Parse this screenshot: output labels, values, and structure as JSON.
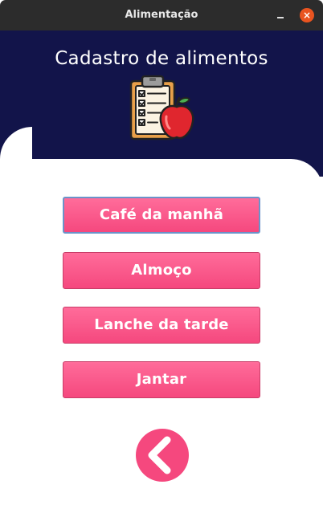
{
  "window": {
    "title": "Alimentação",
    "controls": {
      "minimize": "–",
      "close": "×"
    }
  },
  "header": {
    "title": "Cadastro de alimentos",
    "icon": "clipboard-apple-icon"
  },
  "menu": {
    "items": [
      {
        "label": "Café da manhã",
        "focused": true
      },
      {
        "label": "Almoço",
        "focused": false
      },
      {
        "label": "Lanche da tarde",
        "focused": false
      },
      {
        "label": "Jantar",
        "focused": false
      }
    ]
  },
  "back": {
    "icon": "chevron-left-icon"
  },
  "colors": {
    "header_bg": "#12144a",
    "button": "#f5487e",
    "titlebar": "#2c2c2c",
    "close": "#e95420"
  }
}
